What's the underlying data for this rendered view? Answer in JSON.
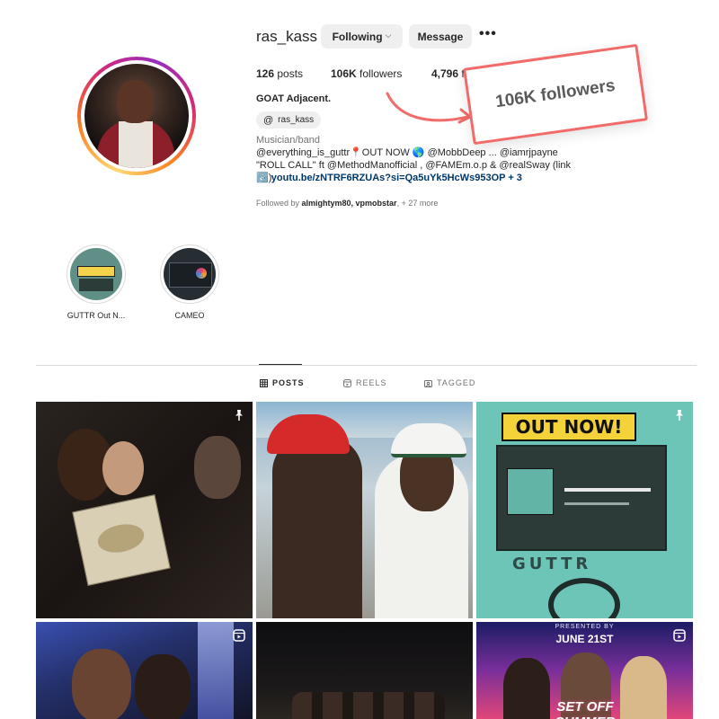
{
  "profile": {
    "username": "ras_kass",
    "following_button": "Following",
    "message_button": "Message",
    "more_button": "•••",
    "posts_count": "126",
    "posts_label": "posts",
    "followers_count": "106K",
    "followers_label": "followers",
    "following_count": "4,796",
    "following_label": "following",
    "full_name": "GOAT Adjacent.",
    "threads_handle": "ras_kass",
    "category": "Musician/band",
    "bio_line1": "@everything_is_guttr📍OUT NOW 🌎 @MobbDeep ... @iamrjpayne",
    "bio_line2": "\"ROLL CALL\" ft @MethodManofficial , @FAMEm.o.p & @realSway (link ⬇️)",
    "link": "youtu.be/zNTRF6RZUAs?si=Qa5uYk5HcWs953OP + 3",
    "followed_by_prefix": "Followed by ",
    "followed_by_names": "almightym80, vpmobstar",
    "followed_by_suffix": ", + 27 more"
  },
  "annotation": {
    "callout_text": "106K followers",
    "accent_color": "#f26b6b"
  },
  "highlights": [
    {
      "label": "GUTTR Out N..."
    },
    {
      "label": "CAMEO"
    }
  ],
  "tabs": [
    {
      "label": "POSTS",
      "icon": "grid-icon",
      "active": true
    },
    {
      "label": "REELS",
      "icon": "reels-icon",
      "active": false
    },
    {
      "label": "TAGGED",
      "icon": "tagged-icon",
      "active": false
    }
  ],
  "posts": [
    {
      "badge": "pin-icon"
    },
    {
      "badge": ""
    },
    {
      "badge": "pin-icon",
      "text_top": "OUT NOW!",
      "text_mid": "GUTTR"
    },
    {
      "badge": "reel-icon"
    },
    {
      "badge": ""
    },
    {
      "badge": "reel-icon",
      "text_top": "PRESENTED BY",
      "text_date": "JUNE 21ST",
      "text_title": "SET OFF SUMMER"
    }
  ]
}
